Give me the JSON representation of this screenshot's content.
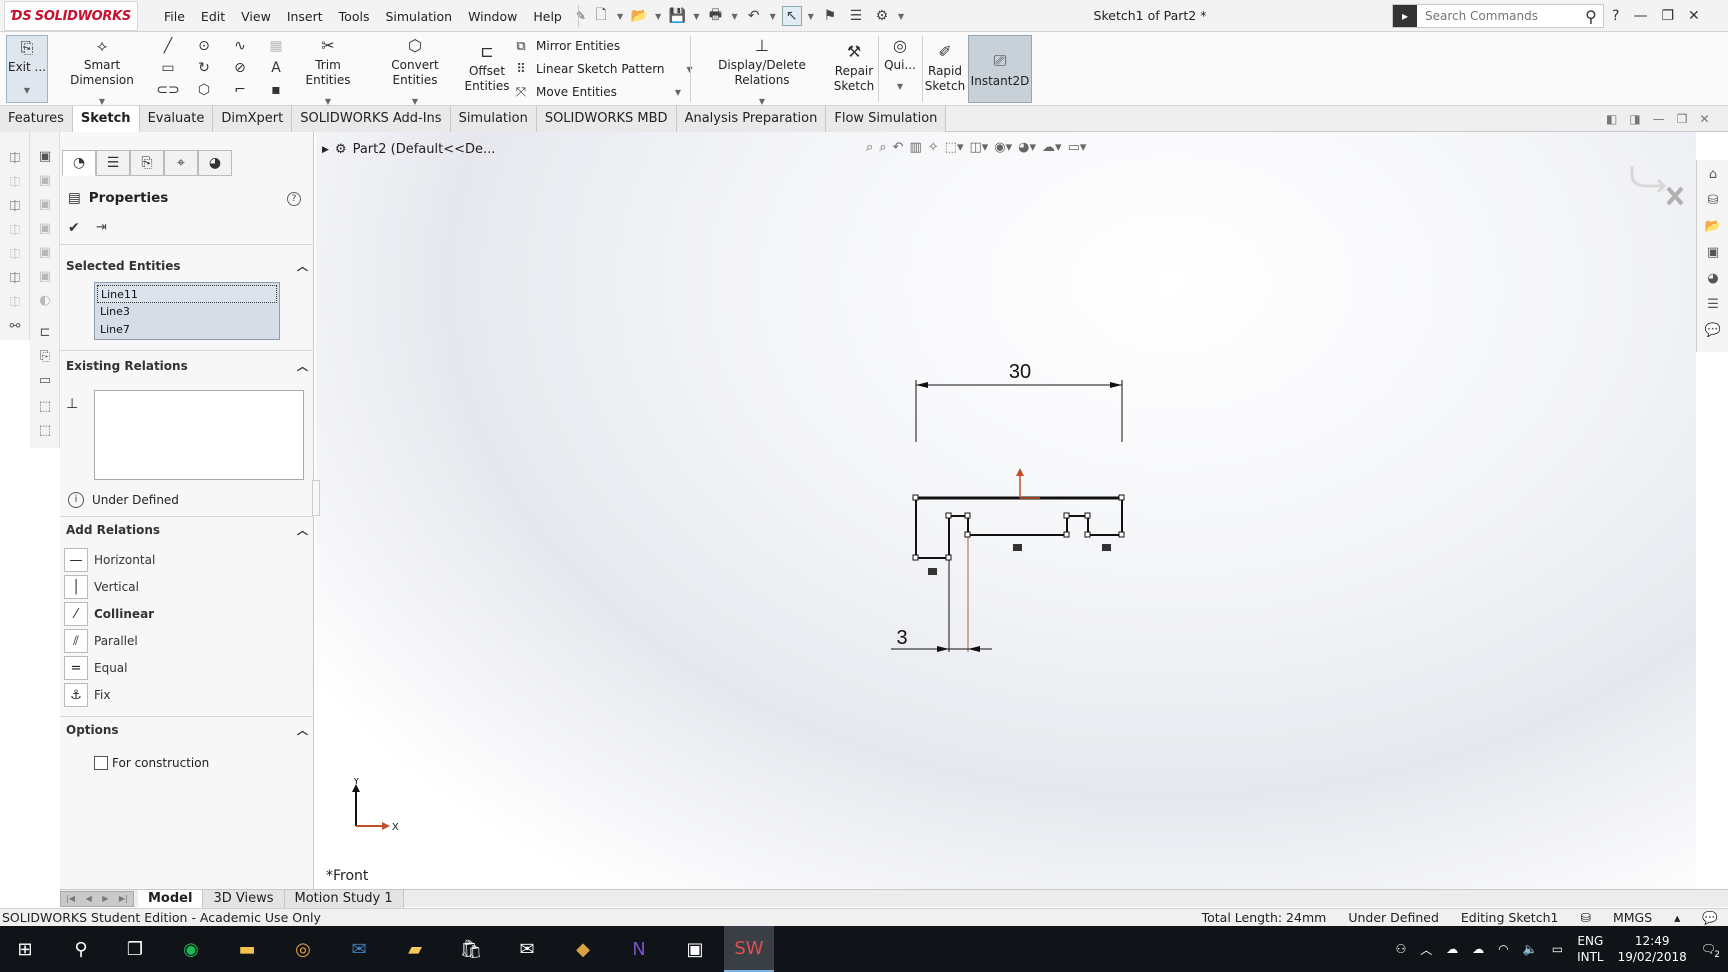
{
  "app": {
    "brand": "SOLIDWORKS",
    "document_title": "Sketch1 of Part2 *"
  },
  "menu": [
    "File",
    "Edit",
    "View",
    "Insert",
    "Tools",
    "Simulation",
    "Window",
    "Help"
  ],
  "search": {
    "placeholder": "Search Commands"
  },
  "ribbon": {
    "exit_label": "Exit ...",
    "smart_dimension": "Smart Dimension",
    "trim": "Trim Entities",
    "convert": "Convert Entities",
    "offset_line1": "Offset",
    "offset_line2": "Entities",
    "mirror": "Mirror Entities",
    "linear_pattern": "Linear Sketch Pattern",
    "move": "Move Entities",
    "display_relations": "Display/Delete Relations",
    "repair_line1": "Repair",
    "repair_line2": "Sketch",
    "quick": "Qui...",
    "rapid_line1": "Rapid",
    "rapid_line2": "Sketch",
    "instant2d": "Instant2D"
  },
  "tabs": [
    "Features",
    "Sketch",
    "Evaluate",
    "DimXpert",
    "SOLIDWORKS Add-Ins",
    "Simulation",
    "SOLIDWORKS MBD",
    "Analysis Preparation",
    "Flow Simulation"
  ],
  "active_tab": "Sketch",
  "property_manager": {
    "title": "Properties",
    "selected_entities_heading": "Selected Entities",
    "selected_entities": [
      "Line11",
      "Line3",
      "Line7"
    ],
    "existing_relations_heading": "Existing Relations",
    "status": "Under Defined",
    "add_relations_heading": "Add Relations",
    "add_relations": [
      "Horizontal",
      "Vertical",
      "Collinear",
      "Parallel",
      "Equal",
      "Fix"
    ],
    "options_heading": "Options",
    "for_construction": "For construction"
  },
  "graphics": {
    "tree_root": "Part2  (Default<<De...",
    "view_name": "*Front",
    "dim_top": "30",
    "dim_bottom": "3",
    "axis_x": "X",
    "axis_y": "Y"
  },
  "bottom_tabs": [
    "Model",
    "3D Views",
    "Motion Study 1"
  ],
  "statusbar": {
    "left": "SOLIDWORKS Student Edition - Academic Use Only",
    "total_length": "Total Length: 24mm",
    "definition": "Under Defined",
    "editing": "Editing Sketch1",
    "units": "MMGS"
  },
  "taskbar": {
    "lang_line1": "ENG",
    "lang_line2": "INTL",
    "time": "12:49",
    "date": "19/02/2018",
    "notifications": "2"
  },
  "colors": {
    "brand_red": "#c8102e",
    "sketch_line": "#111111",
    "origin": "#c0502a",
    "selection_bg": "#d7dde6"
  }
}
